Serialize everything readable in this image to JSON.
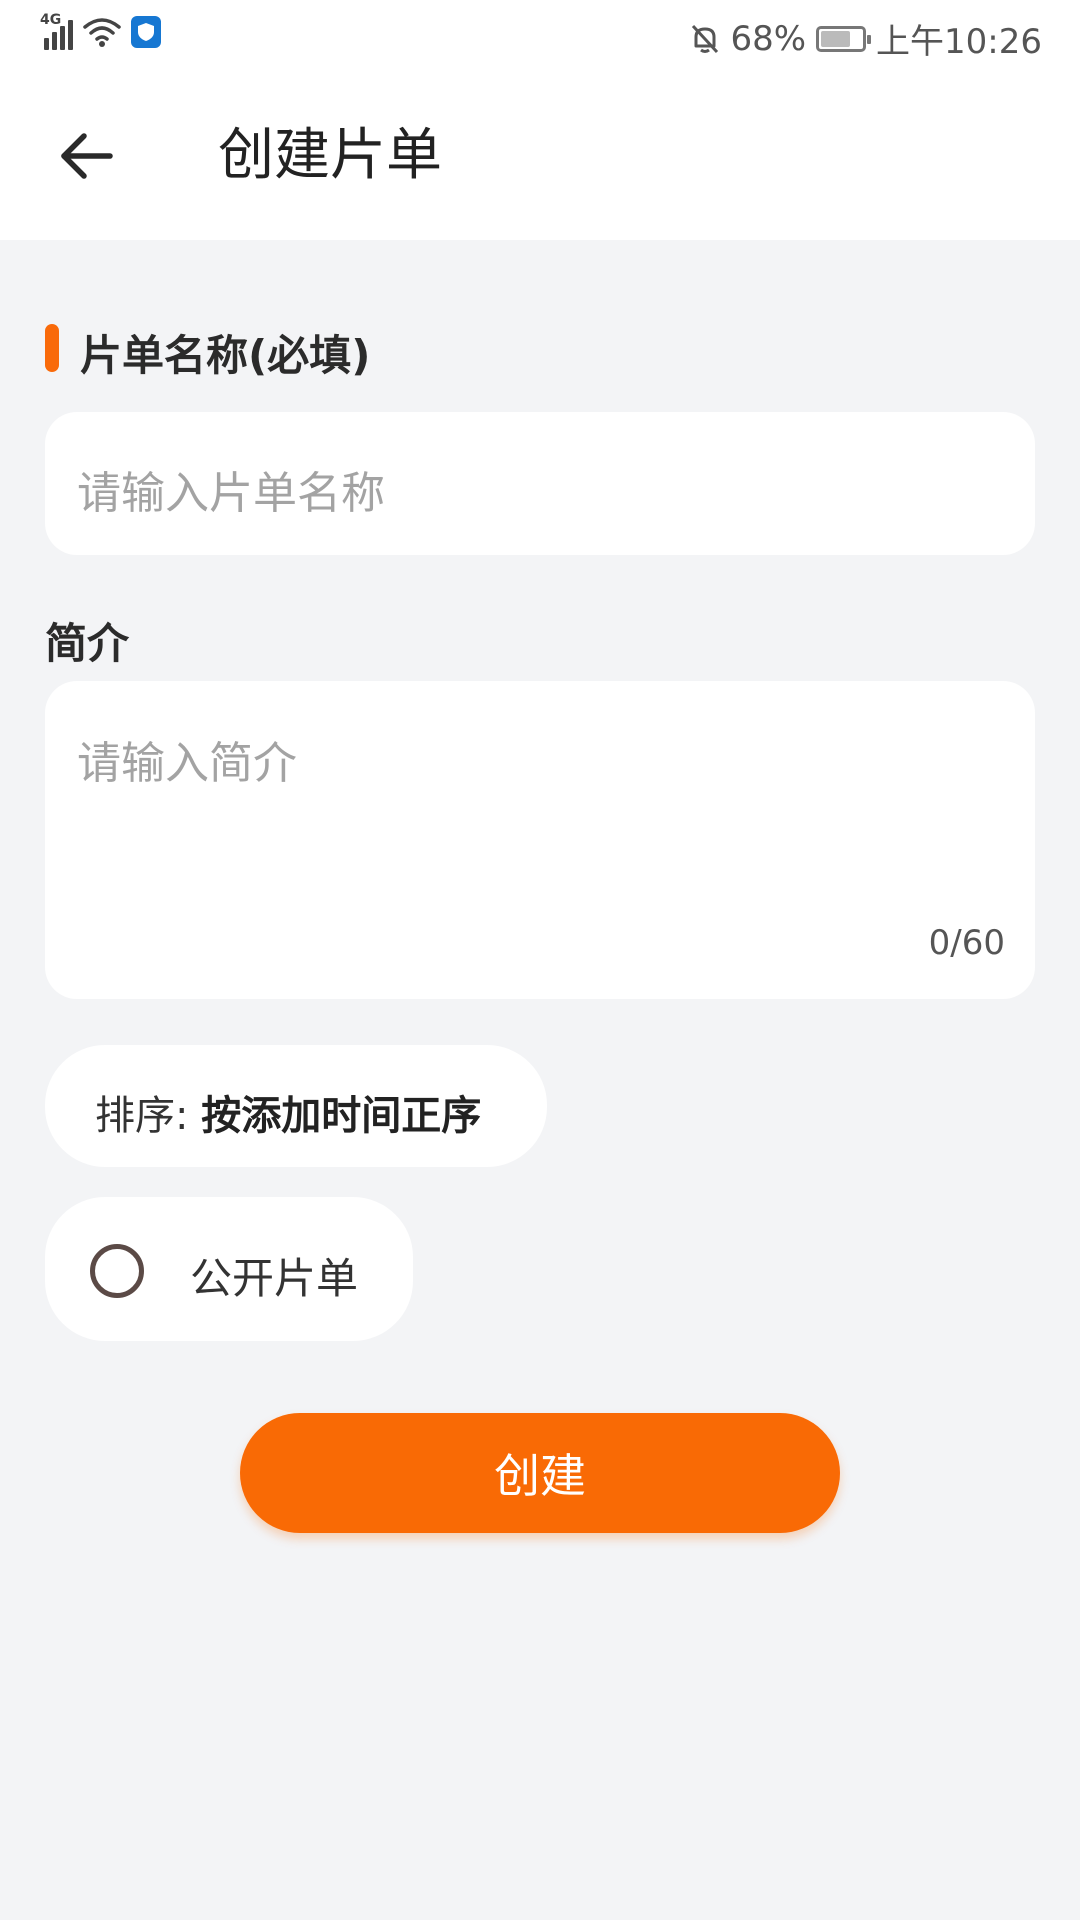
{
  "status_bar": {
    "network": "4G",
    "battery_percent": "68%",
    "time": "上午10:26",
    "icons": [
      "signal-icon",
      "wifi-icon",
      "shield-icon",
      "mute-icon",
      "battery-icon"
    ]
  },
  "header": {
    "title": "创建片单",
    "back_icon": "arrow-left-icon"
  },
  "form": {
    "name_label": "片单名称(必填)",
    "name_placeholder": "请输入片单名称",
    "intro_label": "简介",
    "intro_placeholder": "请输入简介",
    "intro_counter": "0/60",
    "sort_prefix": "排序: ",
    "sort_value": "按添加时间正序",
    "public_label": "公开片单",
    "public_checked": false
  },
  "actions": {
    "create_label": "创建"
  },
  "colors": {
    "accent": "#f96a05",
    "background": "#f3f4f6",
    "card": "#ffffff",
    "placeholder": "#a3a3a3"
  }
}
